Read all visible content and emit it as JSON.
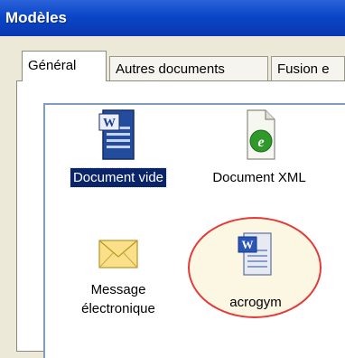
{
  "window": {
    "title": "Modèles"
  },
  "tabs": [
    {
      "label": "Général",
      "active": true
    },
    {
      "label": "Autres documents",
      "active": false
    },
    {
      "label": "Fusion e",
      "active": false
    }
  ],
  "templates": [
    {
      "label": "Document vide",
      "icon": "word-document-icon",
      "selected": true
    },
    {
      "label": "Document XML",
      "icon": "xml-document-icon",
      "selected": false
    },
    {
      "label_line1": "Message",
      "label_line2": "électronique",
      "icon": "email-envelope-icon",
      "selected": false
    },
    {
      "label": "acrogym",
      "icon": "word-template-icon",
      "selected": false,
      "highlighted": true
    }
  ],
  "colors": {
    "titlebar": "#0a46c8",
    "selection": "#0a246a",
    "highlight_ring": "#e53a3a"
  }
}
